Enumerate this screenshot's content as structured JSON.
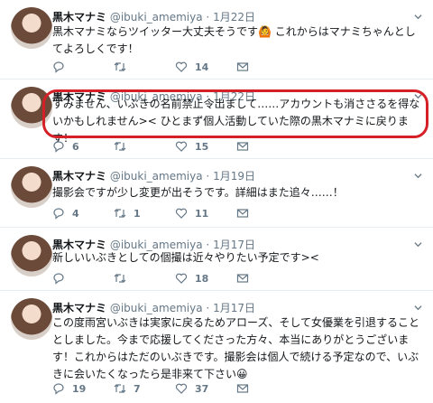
{
  "tweets": [
    {
      "name": "黒木マナミ",
      "handle": "@ibuki_amemiya",
      "date": "1月22日",
      "text": "黒木マナミならツイッター大丈夫そうです🙆 これからはマナミちゃんとしてよろしくです！",
      "reply": "",
      "retweet": "",
      "like": "14"
    },
    {
      "name": "黒木マナミ",
      "handle": "@ibuki_amemiya",
      "date": "1月22日",
      "text": "すみません、いぶきの名前禁止令出まして……アカウントも消ささるを得ないかもしれません>< ひとまず個人活動していた際の黒木マナミに戻ります！",
      "reply": "6",
      "retweet": "",
      "like": "15"
    },
    {
      "name": "黒木マナミ",
      "handle": "@ibuki_amemiya",
      "date": "1月19日",
      "text": "撮影会ですが少し変更が出そうです。詳細はまた追々……！",
      "reply": "4",
      "retweet": "1",
      "like": "11"
    },
    {
      "name": "黒木マナミ",
      "handle": "@ibuki_amemiya",
      "date": "1月17日",
      "text": "新しいいぶきとしての個撮は近々やりたい予定です><",
      "reply": "",
      "retweet": "",
      "like": "18"
    },
    {
      "name": "黒木マナミ",
      "handle": "@ibuki_amemiya",
      "date": "1月17日",
      "text": "この度雨宮いぶきは実家に戻るためアローズ、そして女優業を引退することとしました。今まで応援してくださった方々、本当にありがとうございます！これからはただのいぶきです。撮影会は個人で続ける予定なので、いぶきに会いたくなったら是非来て下さい😀",
      "reply": "19",
      "retweet": "7",
      "like": "37"
    }
  ]
}
